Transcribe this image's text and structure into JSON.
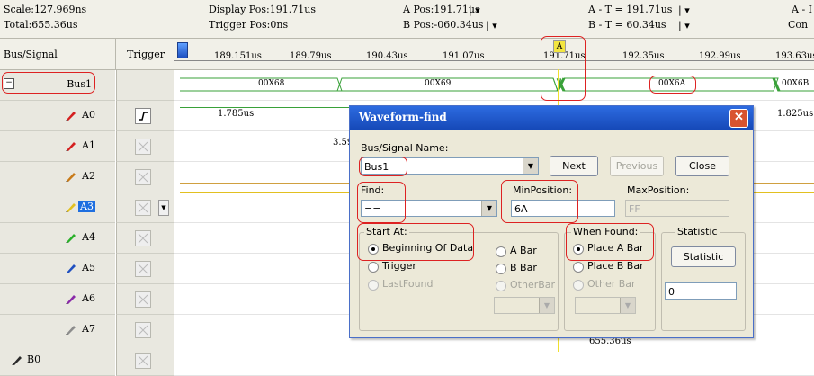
{
  "header": {
    "scale": "Scale:127.969ns",
    "total": "Total:655.36us",
    "display_pos": "Display Pos:191.71us",
    "trigger_pos": "Trigger Pos:0ns",
    "a_pos": "A Pos:191.71us",
    "b_pos": "B Pos:-060.34us",
    "a_minus_t": "A - T = 191.71us",
    "b_minus_t": "B - T = 60.34us",
    "cut_a": "A - I",
    "cut_con": "Con"
  },
  "columns": {
    "bus_signal": "Bus/Signal",
    "trigger": "Trigger"
  },
  "ruler": {
    "ticks": [
      "189.151us",
      "189.79us",
      "190.43us",
      "191.07us",
      "191.71us",
      "192.35us",
      "192.99us",
      "193.63us"
    ],
    "marker": "A"
  },
  "signals": [
    {
      "name": "Bus1",
      "pen": "",
      "color": ""
    },
    {
      "name": "A0",
      "pen": "pencil-icon",
      "color": "#d42020"
    },
    {
      "name": "A1",
      "pen": "pencil-icon",
      "color": "#d42020"
    },
    {
      "name": "A2",
      "pen": "pencil-icon",
      "color": "#c87a18"
    },
    {
      "name": "A3",
      "pen": "pencil-icon",
      "color": "#e2c020"
    },
    {
      "name": "A4",
      "pen": "pencil-icon",
      "color": "#2ab02a"
    },
    {
      "name": "A5",
      "pen": "pencil-icon",
      "color": "#2050c0"
    },
    {
      "name": "A6",
      "pen": "pencil-icon",
      "color": "#8a2aa8"
    },
    {
      "name": "A7",
      "pen": "pencil-icon",
      "color": "#8c8c8c"
    },
    {
      "name": "B0",
      "pen": "pencil-icon",
      "color": "#2a2a2a"
    }
  ],
  "waveform": {
    "bus_values": [
      "00X68",
      "00X69",
      "00X6A",
      "00X6B"
    ],
    "a0_left": "1.785us",
    "a0_right": "1.825us",
    "a1_partial": "3.59",
    "bottom": "655.36us"
  },
  "dialog": {
    "title": "Waveform-find",
    "bus_signal_label": "Bus/Signal Name:",
    "bus_signal_value": "Bus1",
    "next": "Next",
    "previous": "Previous",
    "close": "Close",
    "find_label": "Find:",
    "find_value": "==",
    "min_label": "MinPosition:",
    "min_value": "6A",
    "max_label": "MaxPosition:",
    "max_value": "FF",
    "start_at_label": "Start At:",
    "start_options": [
      "Beginning Of Data",
      "Trigger",
      "LastFound"
    ],
    "bar_options": [
      "A Bar",
      "B Bar",
      "OtherBar"
    ],
    "when_found_label": "When Found:",
    "found_options": [
      "Place A Bar",
      "Place B Bar",
      "Other Bar"
    ],
    "statistic_label": "Statistic",
    "statistic_button": "Statistic",
    "statistic_value": "0"
  },
  "colors": {
    "accent_title": "#1d55cc",
    "cursor_yellow": "#f0e030",
    "highlight_red": "#d22222"
  }
}
